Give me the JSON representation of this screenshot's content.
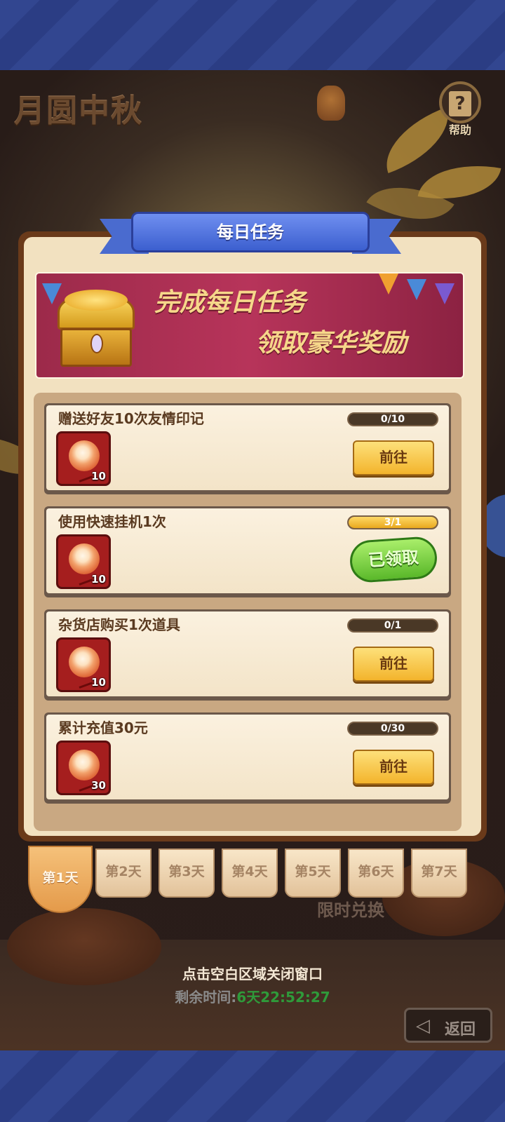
{
  "game": {
    "title": "月圆中秋",
    "help_label": "帮助",
    "help_glyph": "?",
    "limited_exchange": "限时兑换",
    "close_hint": "点击空白区域关闭窗口",
    "remaining_label": "剩余时间:",
    "remaining_value": "6天22:52:27",
    "back_label": "返回",
    "back_arrow": "◁"
  },
  "dialog": {
    "title": "每日任务",
    "banner_line1": "完成每日任务",
    "banner_line2": "领取豪华奖励"
  },
  "tasks": [
    {
      "title": "赠送好友10次友情印记",
      "reward_count": "10",
      "progress_text": "0/10",
      "progress_fraction": 0,
      "action": "前往",
      "state": "go"
    },
    {
      "title": "使用快速挂机1次",
      "reward_count": "10",
      "progress_text": "3/1",
      "progress_fraction": 1,
      "action": "已领取",
      "state": "claimed"
    },
    {
      "title": "杂货店购买1次道具",
      "reward_count": "10",
      "progress_text": "0/1",
      "progress_fraction": 0,
      "action": "前往",
      "state": "go"
    },
    {
      "title": "累计充值30元",
      "reward_count": "30",
      "progress_text": "0/30",
      "progress_fraction": 0,
      "action": "前往",
      "state": "go"
    }
  ],
  "days": [
    "第1天",
    "第2天",
    "第3天",
    "第4天",
    "第5天",
    "第6天",
    "第7天"
  ],
  "active_day_index": 0,
  "colors": {
    "frame_blue": "#2b3d84",
    "ribbon_blue": "#3c5fcf",
    "banner_red": "#b7345a",
    "go_button": "#f3b42c",
    "claimed_green": "#5ab82a",
    "countdown_green": "#2f9a3a"
  },
  "icons": {
    "reward_item": "friendship-medal-icon",
    "help": "question-mark-icon",
    "back": "back-arrow-icon",
    "banner": "treasure-chest-icon"
  }
}
